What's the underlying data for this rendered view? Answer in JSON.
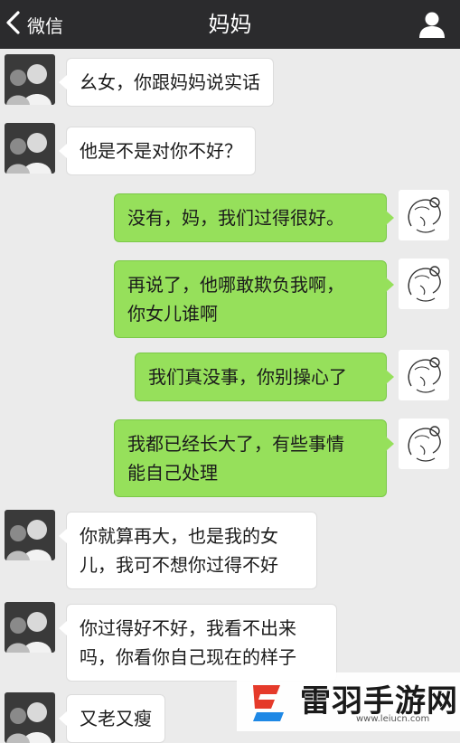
{
  "header": {
    "back_label": "微信",
    "title": "妈妈"
  },
  "messages": [
    {
      "side": "left",
      "lines": [
        "幺女，你跟妈妈说实话"
      ]
    },
    {
      "side": "left",
      "lines": [
        "他是不是对你不好？"
      ]
    },
    {
      "side": "right",
      "lines": [
        "没有，妈，我们过得很好。"
      ]
    },
    {
      "side": "right",
      "lines": [
        "再说了，他哪敢欺负我啊，",
        "你女儿谁啊"
      ]
    },
    {
      "side": "right",
      "lines": [
        "我们真没事，你别操心了"
      ]
    },
    {
      "side": "right",
      "lines": [
        "我都已经长大了，有些事情",
        "能自己处理"
      ]
    },
    {
      "side": "left",
      "lines": [
        "你就算再大，也是我的女",
        "儿，我可不想你过得不好"
      ]
    },
    {
      "side": "left",
      "lines": [
        "你过得好不好，我看不出来",
        "吗，你看你自己现在的样子"
      ]
    },
    {
      "side": "left",
      "lines": [
        "又老又瘦"
      ]
    }
  ],
  "watermark": {
    "logo_icon": "leiyu-logo-icon",
    "name": "雷羽手游网",
    "url": "www.leiucn.com"
  },
  "colors": {
    "topbar": "#2b2b2d",
    "background": "#ebebeb",
    "sent_bubble": "#96e05b",
    "received_bubble": "#ffffff"
  }
}
